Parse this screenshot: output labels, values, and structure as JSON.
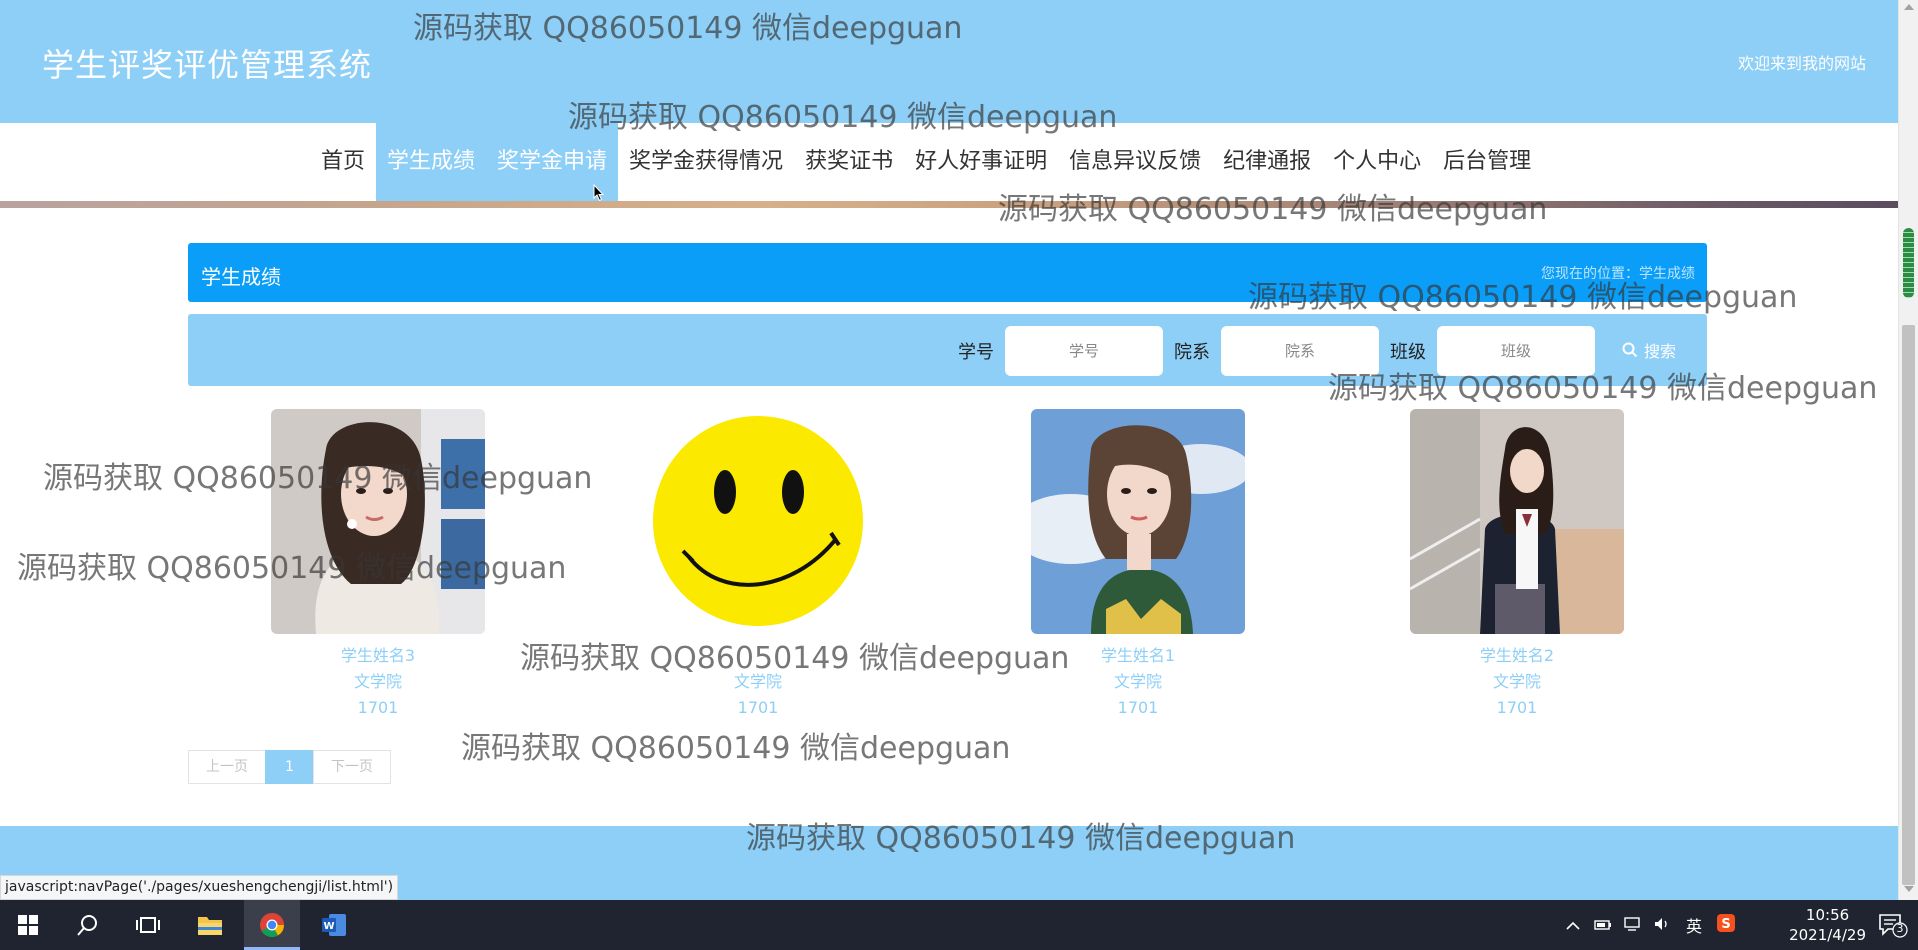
{
  "header": {
    "site_title": "学生评奖评优管理系统",
    "welcome": "欢迎来到我的网站"
  },
  "nav": {
    "items": [
      {
        "label": "首页"
      },
      {
        "label": "学生成绩"
      },
      {
        "label": "奖学金申请"
      },
      {
        "label": "奖学金获得情况"
      },
      {
        "label": "获奖证书"
      },
      {
        "label": "好人好事证明"
      },
      {
        "label": "信息异议反馈"
      },
      {
        "label": "纪律通报"
      },
      {
        "label": "个人中心"
      },
      {
        "label": "后台管理"
      }
    ],
    "active": "学生成绩"
  },
  "breadcrumb": {
    "title": "学生成绩",
    "location": "您现在的位置：学生成绩"
  },
  "search": {
    "student_id_label": "学号",
    "student_id_placeholder": "学号",
    "college_label": "院系",
    "college_placeholder": "院系",
    "class_label": "班级",
    "class_placeholder": "班级",
    "button_label": "搜索"
  },
  "students": [
    {
      "name": "学生姓名3",
      "college": "文学院",
      "class": "1701"
    },
    {
      "name": "",
      "college": "文学院",
      "class": "1701"
    },
    {
      "name": "学生姓名1",
      "college": "文学院",
      "class": "1701"
    },
    {
      "name": "学生姓名2",
      "college": "文学院",
      "class": "1701"
    }
  ],
  "pagination": {
    "prev": "上一页",
    "current": "1",
    "next": "下一页"
  },
  "status_url": "javascript:navPage('./pages/xueshengchengji/list.html')",
  "watermark": "源码获取 QQ86050149 微信deepguan",
  "taskbar": {
    "ime": "英",
    "time": "10:56",
    "date": "2021/4/29",
    "notifications": "3"
  },
  "colors": {
    "header_bg": "#8ecff7",
    "crumb_bg": "#0a9ef9",
    "text_light": "#8ecff7"
  }
}
